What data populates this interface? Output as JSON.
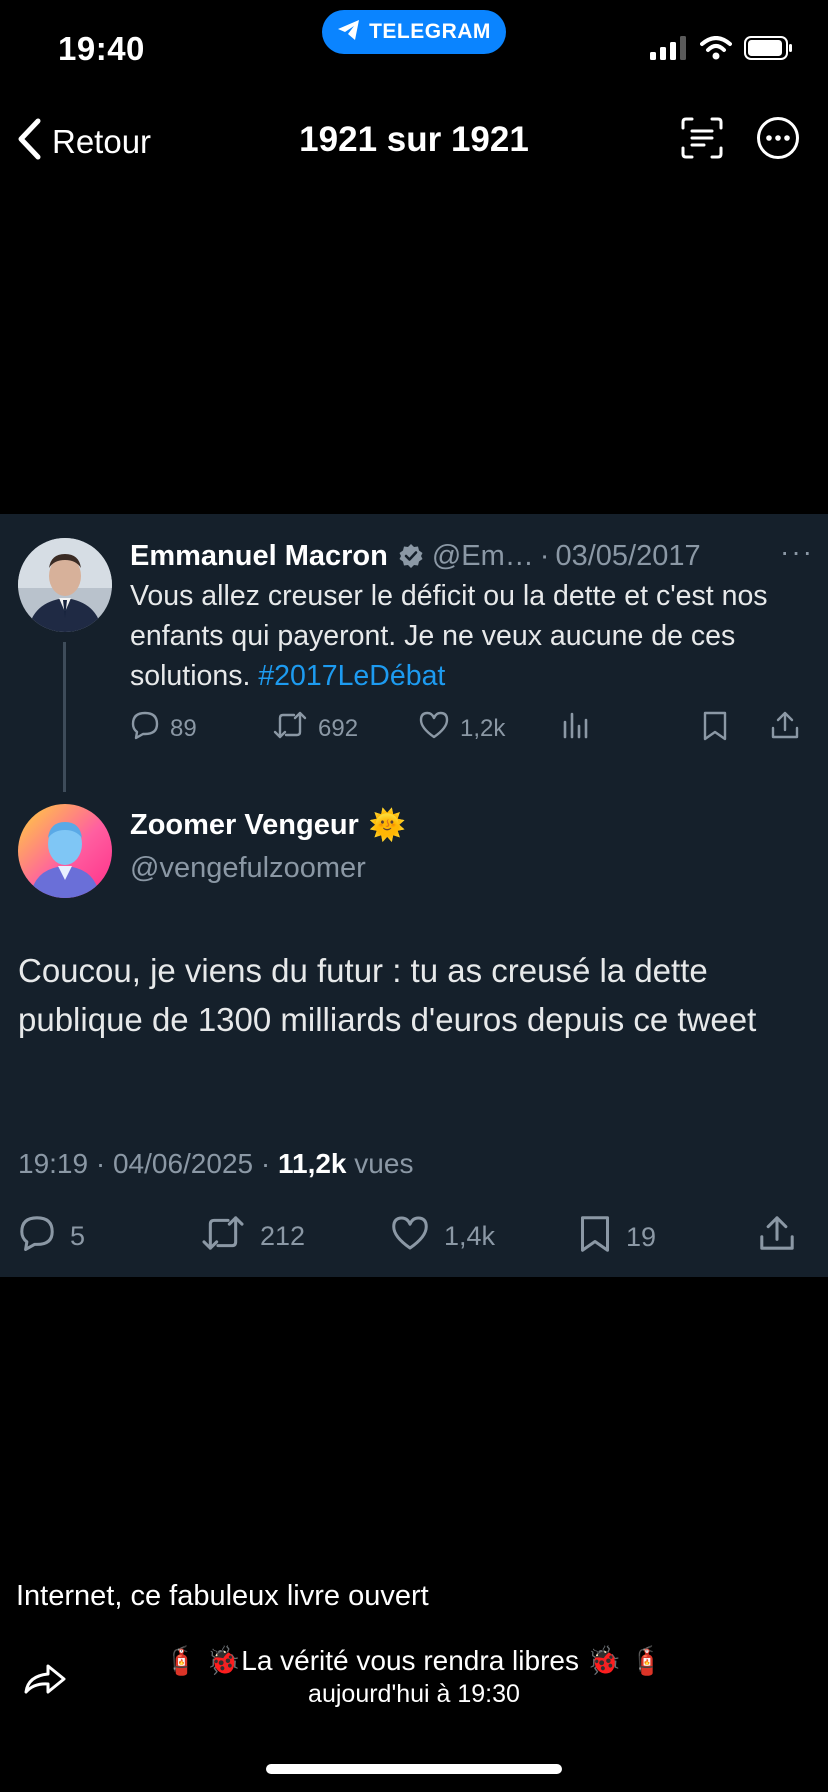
{
  "status_bar": {
    "time": "19:40",
    "app_pill": "TELEGRAM"
  },
  "nav": {
    "back_label": "Retour",
    "title": "1921 sur 1921"
  },
  "quoted_tweet": {
    "author_name": "Emmanuel Macron",
    "handle": "@Em…",
    "separator": "·",
    "date": "03/05/2017",
    "more": "···",
    "text": "Vous allez creuser le déficit ou la dette et c'est nos enfants qui payeront. Je ne veux aucune de ces solutions.",
    "hashtag": "#2017LeDébat",
    "replies": "89",
    "retweets": "692",
    "likes": "1,2k"
  },
  "reply_tweet": {
    "author_name": "Zoomer Vengeur",
    "author_emoji": "🌞",
    "handle": "@vengefulzoomer",
    "text": "Coucou, je viens du futur : tu as creusé la dette publique de 1300 milliards d'euros depuis ce tweet",
    "time_date": "19:19 · 04/06/2025 · ",
    "views_count": "11,2k",
    "views_label": " vues",
    "replies": "5",
    "retweets": "212",
    "likes": "1,4k",
    "bookmarks": "19"
  },
  "post": {
    "caption": "Internet, ce fabuleux livre ouvert",
    "channel_name": "🧯 🐞La vérité vous rendra libres 🐞 🧯",
    "channel_time": "aujourd'hui à 19:30"
  },
  "colors": {
    "card_bg": "#15202b",
    "muted_text": "#8b98a5",
    "link_blue": "#1d9bf0",
    "telegram_blue": "#0a84ff"
  },
  "icons": [
    "telegram-icon",
    "signal-icon",
    "wifi-icon",
    "battery-icon",
    "chevron-left-icon",
    "scan-text-icon",
    "more-icon",
    "verified-icon",
    "reply-icon",
    "retweet-icon",
    "like-icon",
    "analytics-icon",
    "bookmark-icon",
    "share-icon",
    "forward-icon"
  ]
}
